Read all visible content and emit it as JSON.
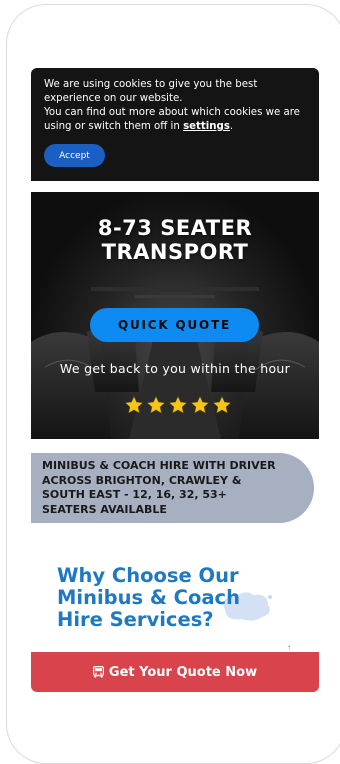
{
  "cookie": {
    "line1": "We are using cookies to give you the best experience on our website.",
    "line2_prefix": "You can find out more about which cookies we are using or switch them off in ",
    "settings_link": "settings",
    "line2_suffix": ".",
    "accept_label": "Accept"
  },
  "hero": {
    "title_line1": "8-73 SEATER",
    "title_line2": "TRANSPORT",
    "quote_button": "QUICK QUOTE",
    "subtitle": "We get back to you within the hour",
    "rating": 5,
    "star_color": "#f5c518"
  },
  "banner": {
    "text": "MINIBUS & COACH HIRE WITH DRIVER ACROSS BRIGHTON, CRAWLEY & SOUTH EAST - 12, 16, 32, 53+ SEATERS AVAILABLE"
  },
  "why": {
    "line1": "Why Choose Our",
    "line2": "Minibus & Coach",
    "line3": "Hire Services?"
  },
  "cta": {
    "label": "Get Your Quote Now",
    "icon": "bus-icon"
  },
  "colors": {
    "accent_blue": "#0d8bf2",
    "heading_blue": "#1f78c2",
    "cta_red": "#d9444c",
    "banner_grey": "#a6b0c0"
  }
}
